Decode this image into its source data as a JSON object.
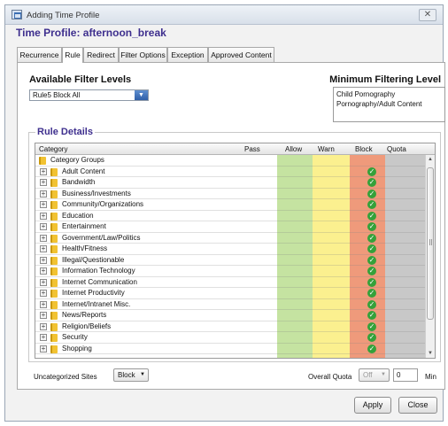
{
  "window": {
    "title": "Adding Time Profile",
    "close_glyph": "✕"
  },
  "profile_title": "Time Profile: afternoon_break",
  "tabs": [
    {
      "label": "Recurrence"
    },
    {
      "label": "Rule"
    },
    {
      "label": "Redirect"
    },
    {
      "label": "Filter Options"
    },
    {
      "label": "Exception"
    },
    {
      "label": "Approved Content"
    }
  ],
  "active_tab": "Rule",
  "filter": {
    "heading": "Available Filter Levels",
    "selected": "Rule5 Block All",
    "arrow": "▼"
  },
  "minimum": {
    "heading": "Minimum Filtering Level",
    "items": [
      "Child Pornography",
      "Pornography/Adult Content"
    ]
  },
  "rule_details": {
    "heading": "Rule Details",
    "columns": [
      "Category",
      "Pass",
      "Allow",
      "Warn",
      "Block",
      "Quota"
    ],
    "group_label": "Category Groups",
    "rows": [
      "Adult Content",
      "Bandwidth",
      "Business/Investments",
      "Community/Organizations",
      "Education",
      "Entertainment",
      "Government/Law/Politics",
      "Health/Fitness",
      "Illegal/Questionable",
      "Information Technology",
      "Internet Communication",
      "Internet Productivity",
      "Internet/Intranet Misc.",
      "News/Reports",
      "Religion/Beliefs",
      "Security",
      "Shopping"
    ],
    "expand_glyph": "+",
    "check_glyph": "✓",
    "scroll_up": "▲",
    "scroll_down": "▼"
  },
  "uncategorized": {
    "label": "Uncategorized Sites",
    "value": "Block",
    "arrow": "▼"
  },
  "quota": {
    "label": "Overall Quota",
    "value": "Off",
    "arrow": "▼",
    "minutes": "0",
    "unit": "Min"
  },
  "buttons": {
    "apply": "Apply",
    "close": "Close"
  },
  "colors": {
    "allow": "#c5e3a1",
    "warn": "#fbf08f",
    "block": "#ef9a7b",
    "quota": "#c8c8c8",
    "accent": "#3e2f8e"
  }
}
